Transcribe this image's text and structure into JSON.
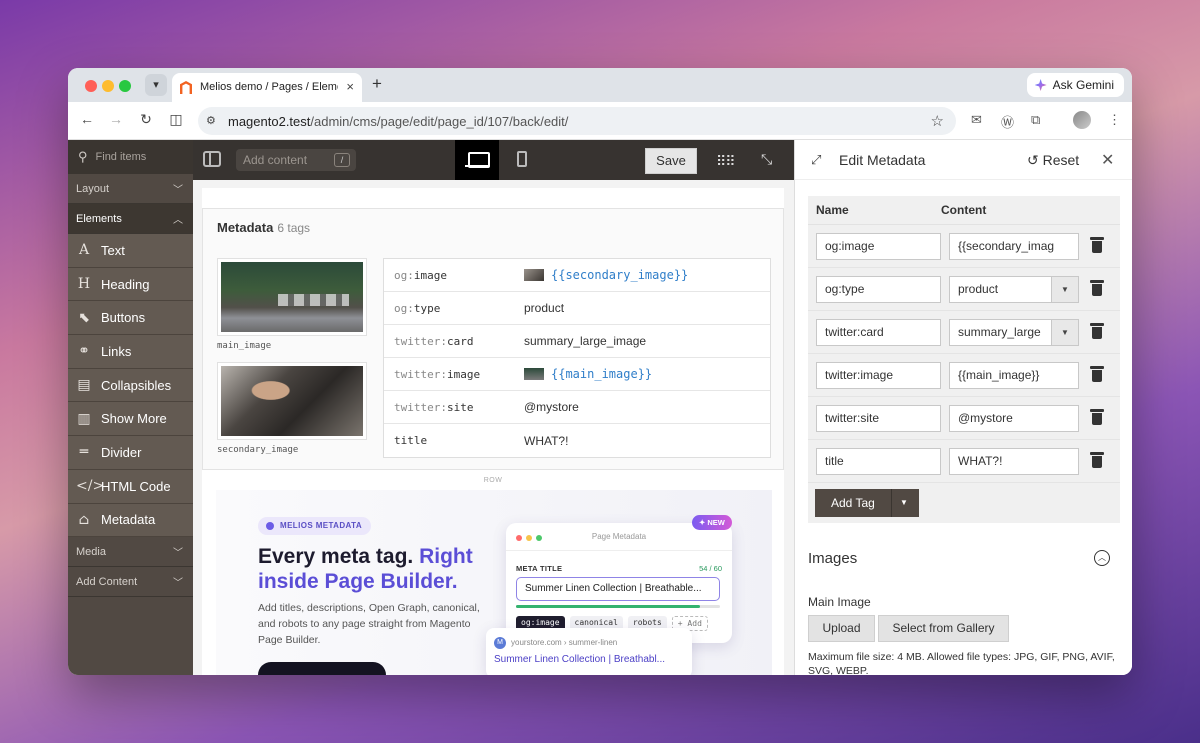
{
  "browser": {
    "tab_title": "Melios demo / Pages / Elements",
    "tab_close": "×",
    "new_tab": "+",
    "gemini_label": "Ask Gemini",
    "url_host": "magento2.test",
    "url_path": "/admin/cms/page/edit/page_id/107/back/edit/"
  },
  "sidebar": {
    "search_placeholder": "Find items",
    "groups": {
      "layout": "Layout",
      "elements": "Elements",
      "media": "Media",
      "add_content": "Add Content"
    },
    "items": [
      {
        "label": "Text",
        "icon": "A"
      },
      {
        "label": "Heading",
        "icon": "H"
      },
      {
        "label": "Buttons",
        "icon": "⬉"
      },
      {
        "label": "Links",
        "icon": "⚭"
      },
      {
        "label": "Collapsibles",
        "icon": "▤"
      },
      {
        "label": "Show More",
        "icon": "▥"
      },
      {
        "label": "Divider",
        "icon": "═"
      },
      {
        "label": "HTML Code",
        "icon": "</>"
      },
      {
        "label": "Metadata",
        "icon": "⌂"
      }
    ]
  },
  "toolbar": {
    "add_content_placeholder": "Add content",
    "shortcut": "/",
    "save_label": "Save"
  },
  "metadata_block": {
    "title": "Metadata",
    "count": "6 tags",
    "images": [
      {
        "caption": "main_image"
      },
      {
        "caption": "secondary_image"
      }
    ],
    "rows": [
      {
        "prefix": "og:",
        "key": "image",
        "value": "{{secondary_image}}",
        "is_token": true
      },
      {
        "prefix": "og:",
        "key": "type",
        "value": "product",
        "is_token": false
      },
      {
        "prefix": "twitter:",
        "key": "card",
        "value": "summary_large_image",
        "is_token": false
      },
      {
        "prefix": "twitter:",
        "key": "image",
        "value": "{{main_image}}",
        "is_token": true
      },
      {
        "prefix": "twitter:",
        "key": "site",
        "value": "@mystore",
        "is_token": false
      },
      {
        "prefix": "",
        "key": "title",
        "value": "WHAT?!",
        "is_token": false
      }
    ],
    "row_label": "ROW"
  },
  "promo": {
    "pill": "MELIOS METADATA",
    "headline_dark": "Every meta tag.",
    "headline_accent_1": "Right",
    "headline_accent_2": "inside Page Builder.",
    "subtext": "Add titles, descriptions, Open Graph, canonical, and robots to any page straight from Magento Page Builder.",
    "card": {
      "title": "Page Metadata",
      "new_badge": "✦ NEW",
      "meta_title_label": "META TITLE",
      "char_count": "54 / 60",
      "field_value": "Summer Linen Collection | Breathable...",
      "progress": 0.9,
      "chips": [
        "og:image",
        "canonical",
        "robots",
        "+ Add"
      ]
    },
    "serp": {
      "favicon": "M",
      "url": "yourstore.com › summer-linen",
      "title": "Summer Linen Collection | Breathabl..."
    }
  },
  "panel": {
    "title": "Edit Metadata",
    "reset_label": "Reset",
    "col_name": "Name",
    "col_content": "Content",
    "rows": [
      {
        "name": "og:image",
        "content": "{{secondary_imag",
        "select": false
      },
      {
        "name": "og:type",
        "content": "product",
        "select": true
      },
      {
        "name": "twitter:card",
        "content": "summary_large",
        "select": true
      },
      {
        "name": "twitter:image",
        "content": "{{main_image}}",
        "select": false
      },
      {
        "name": "twitter:site",
        "content": "@mystore",
        "select": false
      },
      {
        "name": "title",
        "content": "WHAT?!",
        "select": false
      }
    ],
    "add_tag_label": "Add Tag",
    "images_heading": "Images",
    "main_image_label": "Main Image",
    "upload_label": "Upload",
    "gallery_label": "Select from Gallery",
    "file_note": "Maximum file size: 4 MB. Allowed file types: JPG, GIF, PNG, AVIF, SVG, WEBP."
  },
  "colors": {
    "magento_sidebar": "#514943",
    "token_blue": "#2f7ec9",
    "accent_purple": "#5b4ed6"
  }
}
